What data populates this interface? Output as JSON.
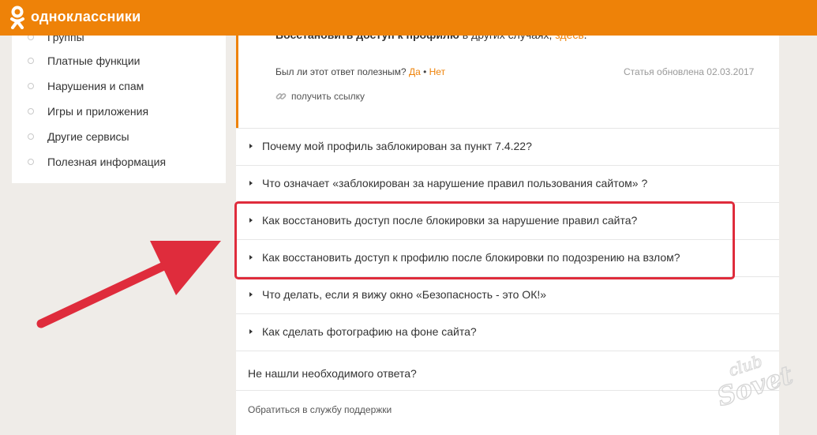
{
  "header": {
    "brand": "одноклассники",
    "logo_icon": "ok-logo-icon",
    "brand_color": "#ee8208"
  },
  "sidebar": {
    "items": [
      {
        "label": "Группы"
      },
      {
        "label": "Платные функции"
      },
      {
        "label": "Нарушения и спам"
      },
      {
        "label": "Игры и приложения"
      },
      {
        "label": "Другие сервисы"
      },
      {
        "label": "Полезная информация"
      }
    ]
  },
  "article": {
    "restore_bold": "Восстановить доступ к профилю",
    "restore_rest": " в других случаях, ",
    "restore_link": "здесь",
    "restore_end": ".",
    "helpful_q": "Был ли этот ответ полезным?",
    "yes": "Да",
    "bullet": " • ",
    "no": "Нет",
    "updated": "Статья обновлена 02.03.2017",
    "get_link": "получить ссылку",
    "get_link_icon": "chain-link-icon"
  },
  "questions": [
    {
      "text": "Почему мой профиль заблокирован за пункт 7.4.22?"
    },
    {
      "text": "Что означает «заблокирован за нарушение правил пользования сайтом» ?"
    },
    {
      "text": "Как восстановить доступ после блокировки за нарушение правил сайта?"
    },
    {
      "text": "Как восстановить доступ к профилю после блокировки по подозрению на взлом?"
    },
    {
      "text": "Что делать, если я вижу окно «Безопасность - это ОК!»"
    },
    {
      "text": "Как сделать фотографию на фоне сайта?"
    }
  ],
  "footer": {
    "not_found": "Не нашли необходимого ответа?",
    "support": "Обратиться в службу поддержки"
  },
  "annotation": {
    "highlight_color": "#df2c3c",
    "arrow_icon": "red-arrow-icon"
  },
  "watermark": {
    "text": "club Sovet"
  }
}
